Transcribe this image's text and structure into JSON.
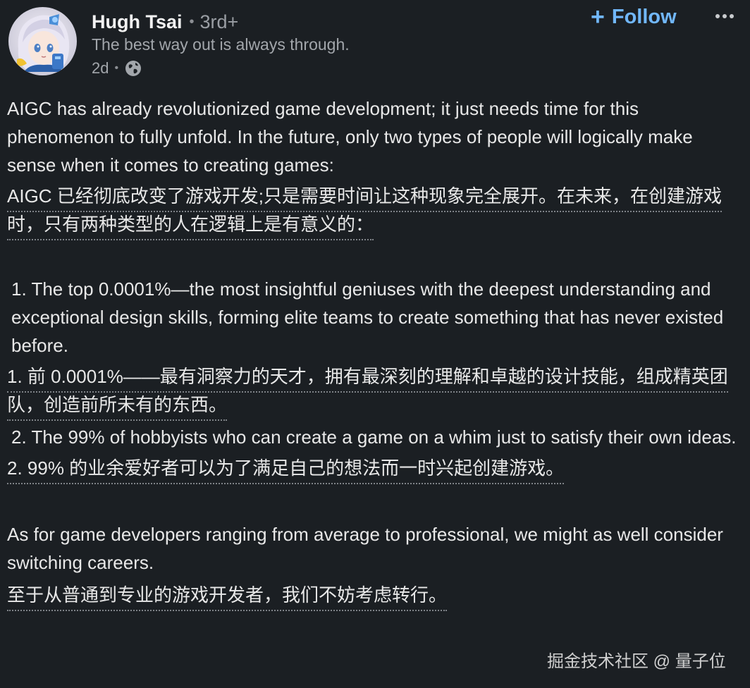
{
  "author": {
    "name": "Hugh Tsai",
    "degree": "3rd+",
    "headline": "The best way out is always through.",
    "time": "2d",
    "separator": "•"
  },
  "actions": {
    "follow_plus": "+",
    "follow_label": "Follow"
  },
  "icons": {
    "globe": "globe-icon",
    "more": "more-horizontal-icon",
    "avatar": "avatar"
  },
  "post": {
    "p1_en": "AIGC has already revolutionized game development; it just needs time for this phenomenon to fully unfold. In the future, only two types of people will logically make sense when it comes to creating games:",
    "p1_zh": "AIGC 已经彻底改变了游戏开发;只是需要时间让这种现象完全展开。在未来，在创建游戏时，只有两种类型的人在逻辑上是有意义的：",
    "item1_en": "1. The top 0.0001%—the most insightful geniuses with the deepest understanding and exceptional design skills, forming elite teams to create something that has never existed before.",
    "item1_zh": "1. 前 0.0001%——最有洞察力的天才，拥有最深刻的理解和卓越的设计技能，组成精英团队，创造前所未有的东西。",
    "item2_en": "2. The 99% of hobbyists who can create a game on a whim just to satisfy their own ideas.",
    "item2_zh": "2. 99% 的业余爱好者可以为了满足自己的想法而一时兴起创建游戏。",
    "p3_en": "As for game developers ranging from average to professional, we might as well consider switching careers.",
    "p3_zh": "至于从普通到专业的游戏开发者，我们不妨考虑转行。"
  },
  "watermark": "掘金技术社区 @ 量子位",
  "colors": {
    "background": "#1b1f23",
    "accent": "#71b7fb",
    "muted": "#a2a6ab"
  }
}
